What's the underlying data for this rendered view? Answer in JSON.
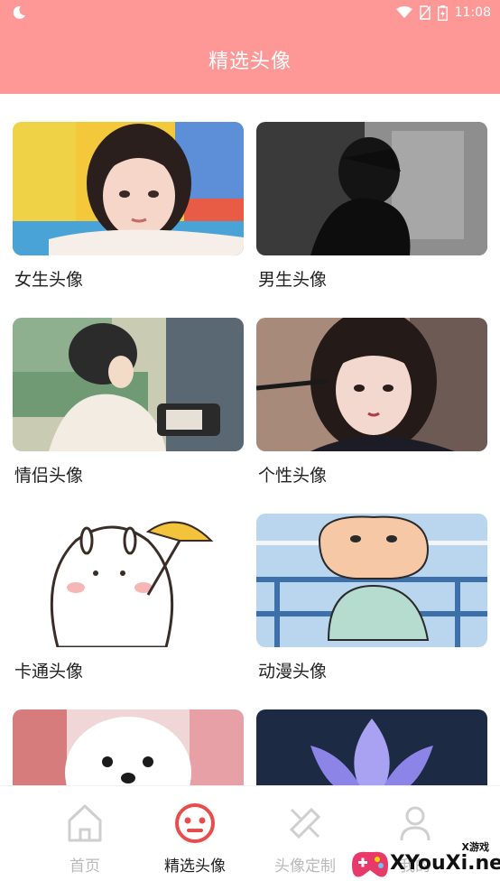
{
  "status_bar": {
    "time": "11:08"
  },
  "header": {
    "title": "精选头像"
  },
  "categories": [
    {
      "label": "女生头像",
      "icon": "girl-avatar-photo"
    },
    {
      "label": "男生头像",
      "icon": "boy-avatar-photo"
    },
    {
      "label": "情侣头像",
      "icon": "couple-avatar-illustration"
    },
    {
      "label": "个性头像",
      "icon": "personality-avatar-photo"
    },
    {
      "label": "卡通头像",
      "icon": "cartoon-avatar-illustration"
    },
    {
      "label": "动漫头像",
      "icon": "anime-avatar-illustration"
    },
    {
      "label": "",
      "icon": "puppy-photo"
    },
    {
      "label": "",
      "icon": "lotus-flower-photo"
    }
  ],
  "bottom_nav": {
    "items": [
      {
        "label": "首页",
        "icon": "home-icon",
        "active": false
      },
      {
        "label": "精选头像",
        "icon": "face-icon",
        "active": true
      },
      {
        "label": "头像定制",
        "icon": "customize-icon",
        "active": false
      },
      {
        "label": "我的",
        "icon": "profile-icon",
        "active": false
      }
    ]
  },
  "watermark": {
    "text": "XYouXi.net",
    "sub": "X游戏"
  },
  "colors": {
    "accent": "#fe9896",
    "active_nav": "#e84c4c",
    "inactive_nav": "#c8c8c8"
  }
}
